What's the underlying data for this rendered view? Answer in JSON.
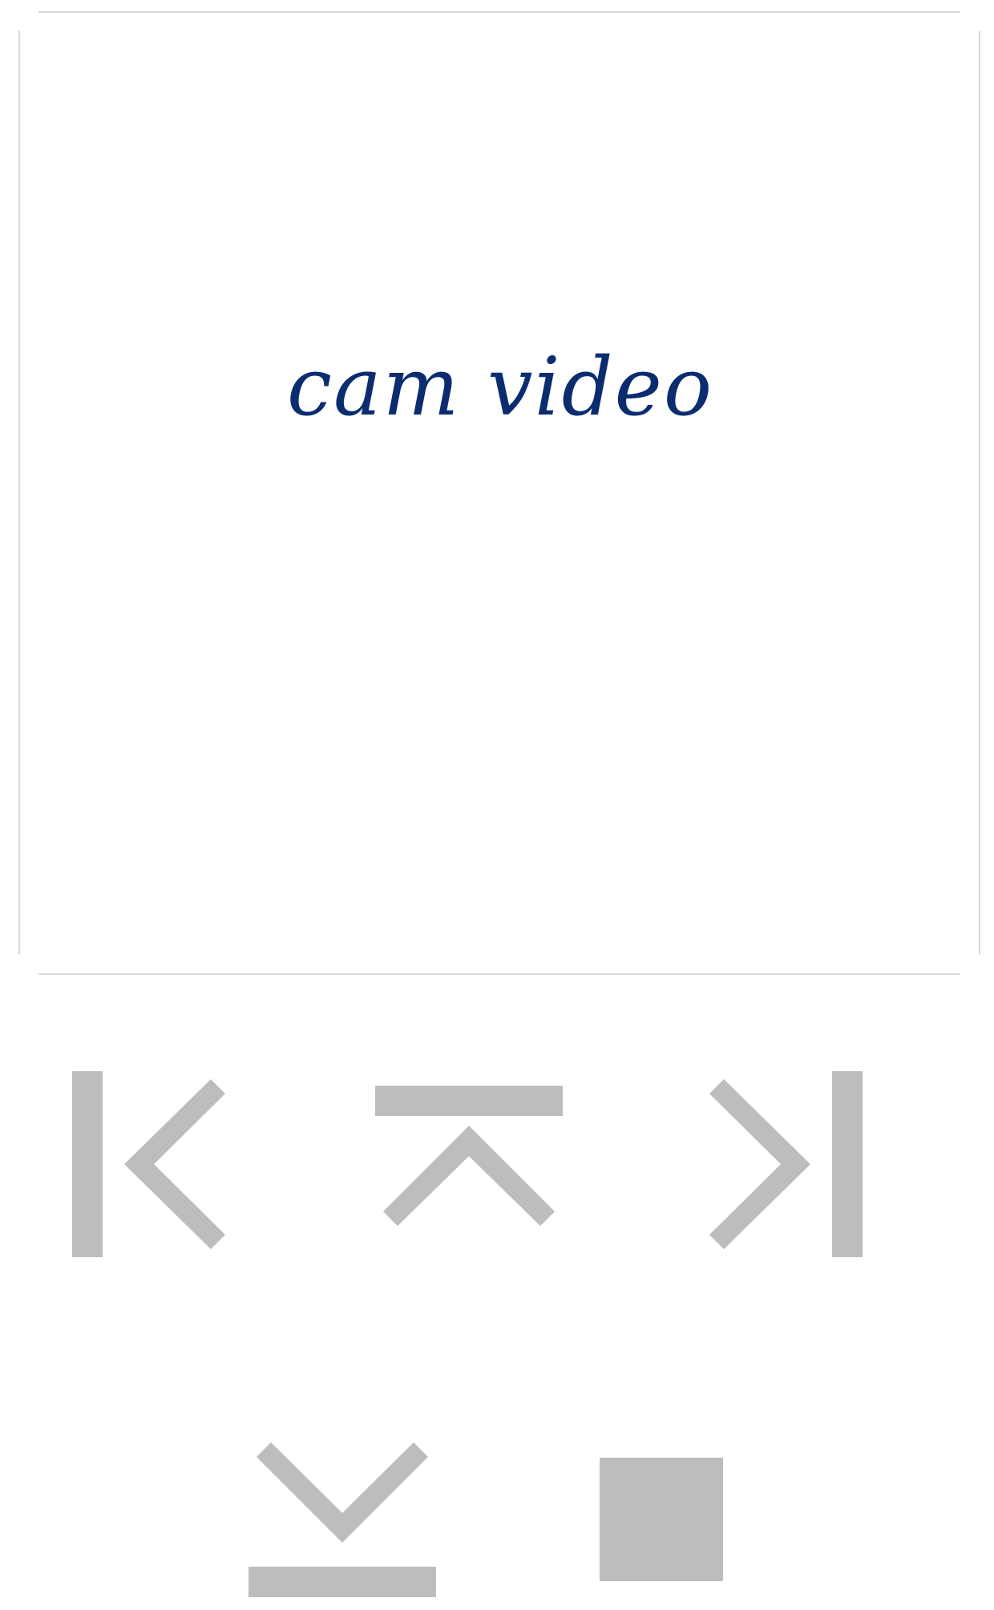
{
  "video": {
    "label": "cam video"
  },
  "controls": [
    {
      "name": "pan-left",
      "icon": "arrow-left-bar-icon"
    },
    {
      "name": "tilt-up",
      "icon": "arrow-up-bar-icon"
    },
    {
      "name": "pan-right",
      "icon": "arrow-right-bar-icon"
    },
    {
      "name": "tilt-down",
      "icon": "arrow-down-bar-icon"
    },
    {
      "name": "stop",
      "icon": "stop-square-icon"
    }
  ],
  "colors": {
    "icon": "#bdbdbd",
    "label": "#0b2c6f",
    "rule": "#d8d8d8",
    "background": "#ffffff"
  }
}
